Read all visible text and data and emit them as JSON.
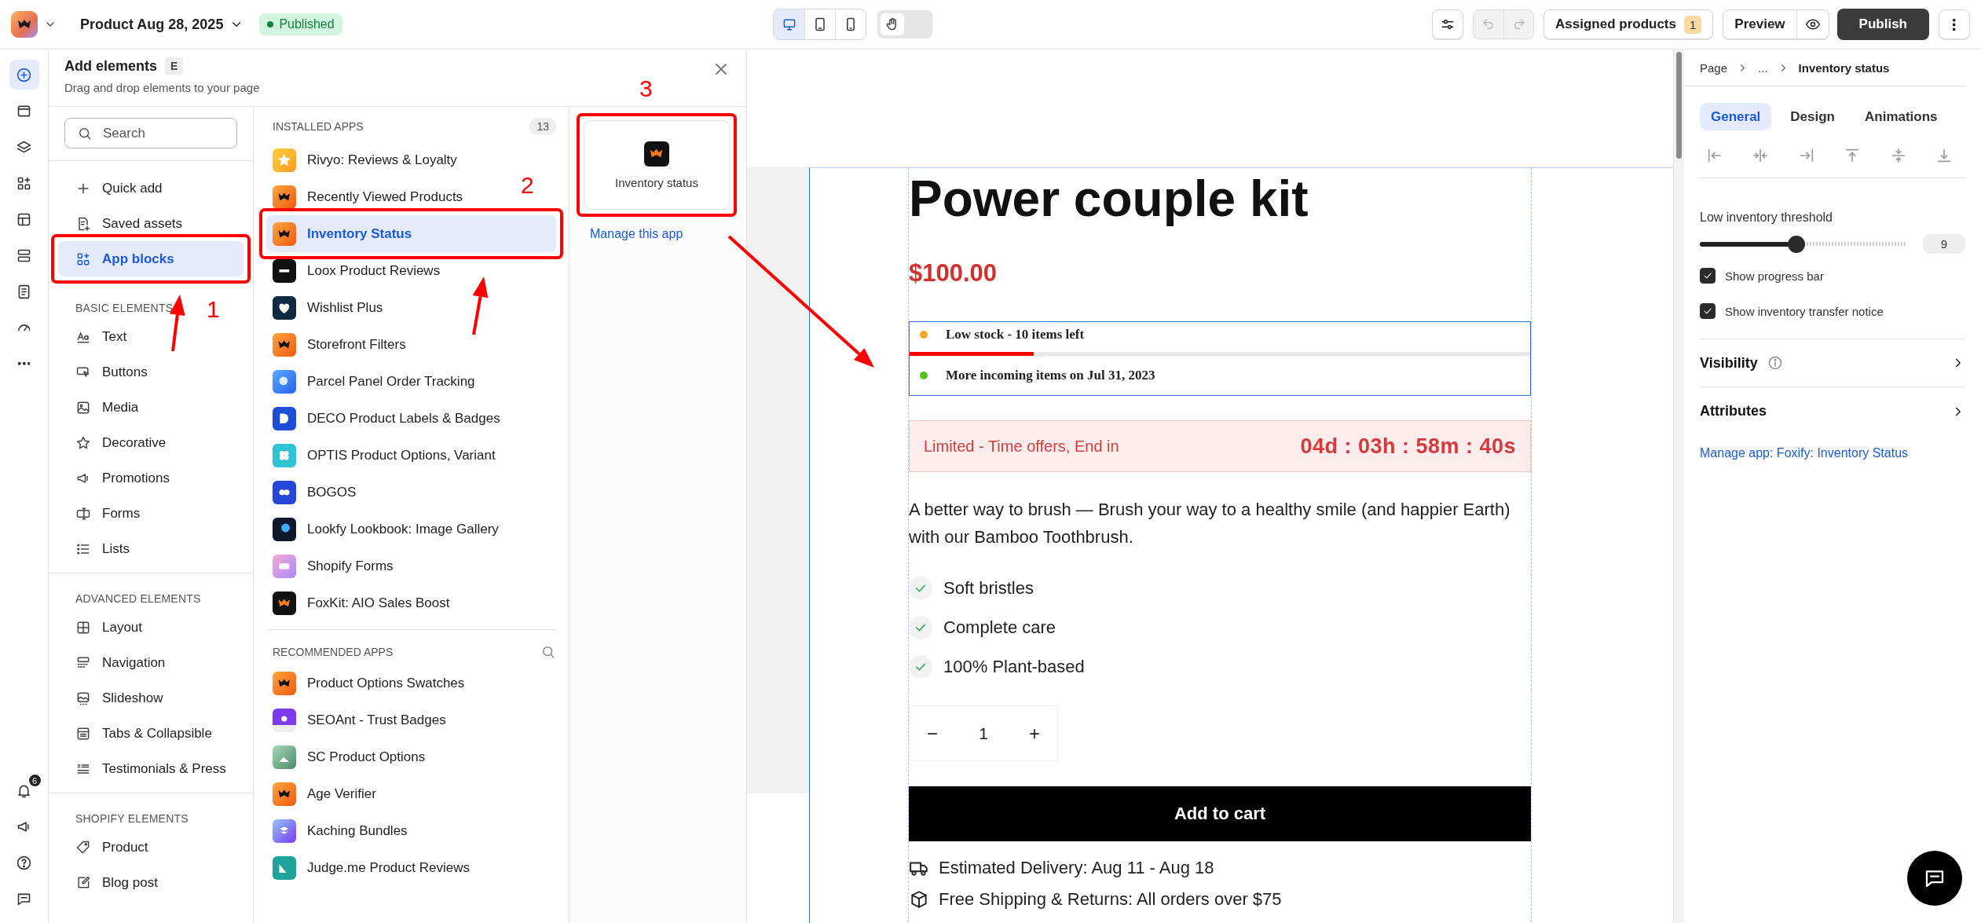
{
  "top_bar": {
    "product_title": "Product Aug 28, 2025",
    "status": "Published",
    "devices": [
      {
        "kind": "desktop",
        "selected": true
      },
      {
        "kind": "tablet",
        "selected": false
      },
      {
        "kind": "mobile",
        "selected": false
      }
    ],
    "hand_tool": {
      "on": false
    },
    "assigned_products": {
      "label": "Assigned products",
      "count": "1"
    },
    "preview": "Preview",
    "publish": "Publish"
  },
  "left_rail": {
    "items": [
      {
        "kind": "add",
        "selected": true
      },
      {
        "kind": "sections",
        "selected": false
      },
      {
        "kind": "layers",
        "selected": false
      },
      {
        "kind": "apps",
        "selected": false
      },
      {
        "kind": "template",
        "selected": false
      },
      {
        "kind": "stack",
        "selected": false
      },
      {
        "kind": "page",
        "selected": false
      },
      {
        "kind": "gauge",
        "selected": false
      },
      {
        "kind": "more",
        "selected": false
      }
    ],
    "bottom_items": [
      {
        "kind": "bell",
        "badge": "6"
      },
      {
        "kind": "megaphone"
      },
      {
        "kind": "help"
      },
      {
        "kind": "chat"
      }
    ]
  },
  "add_elements": {
    "title": "Add elements",
    "shortcut": "E",
    "subtitle": "Drag and drop elements to your page",
    "search": {
      "placeholder": "Search"
    },
    "top_items": [
      {
        "label": "Quick add",
        "kind": "plus",
        "selected": false
      },
      {
        "label": "Saved assets",
        "kind": "saved",
        "selected": false
      },
      {
        "label": "App blocks",
        "kind": "apps",
        "selected": true
      }
    ],
    "groups": [
      {
        "heading": "BASIC ELEMENTS",
        "items": [
          {
            "label": "Text",
            "kind": "text",
            "selected": false
          },
          {
            "label": "Buttons",
            "kind": "cursor",
            "selected": false
          },
          {
            "label": "Media",
            "kind": "image",
            "selected": false
          },
          {
            "label": "Decorative",
            "kind": "star",
            "selected": false
          },
          {
            "label": "Promotions",
            "kind": "megaphone",
            "selected": false
          },
          {
            "label": "Forms",
            "kind": "form",
            "selected": false
          },
          {
            "label": "Lists",
            "kind": "list",
            "selected": false
          }
        ]
      },
      {
        "heading": "ADVANCED ELEMENTS",
        "items": [
          {
            "label": "Layout",
            "kind": "grid",
            "selected": false
          },
          {
            "label": "Navigation",
            "kind": "nav",
            "selected": false
          },
          {
            "label": "Slideshow",
            "kind": "slideshow",
            "selected": false
          },
          {
            "label": "Tabs & Collapsible",
            "kind": "tabs",
            "selected": false
          },
          {
            "label": "Testimonials & Press",
            "kind": "testimonials",
            "selected": false
          }
        ]
      },
      {
        "heading": "SHOPIFY ELEMENTS",
        "items": [
          {
            "label": "Product",
            "kind": "tag",
            "selected": false
          },
          {
            "label": "Blog post",
            "kind": "edit",
            "selected": false
          }
        ]
      }
    ],
    "installed": {
      "heading": "INSTALLED APPS",
      "count": "13",
      "items": [
        {
          "label": "Rivyo: Reviews & Loyalty",
          "kind": "star",
          "selected": false
        },
        {
          "label": "Recently Viewed Products",
          "kind": "foxify",
          "selected": false
        },
        {
          "label": "Inventory Status",
          "kind": "foxify",
          "selected": true
        },
        {
          "label": "Loox Product Reviews",
          "kind": "loox",
          "selected": false
        },
        {
          "label": "Wishlist Plus",
          "kind": "heart",
          "selected": false
        },
        {
          "label": "Storefront Filters",
          "kind": "foxify",
          "selected": false
        },
        {
          "label": "Parcel Panel Order Tracking",
          "kind": "parcel",
          "selected": false
        },
        {
          "label": "DECO Product Labels & Badges",
          "kind": "deco",
          "selected": false
        },
        {
          "label": "OPTIS Product Options, Variant",
          "kind": "optis",
          "selected": false
        },
        {
          "label": "BOGOS",
          "kind": "bogos",
          "selected": false
        },
        {
          "label": "Lookfy Lookbook: Image Gallery",
          "kind": "lookfy",
          "selected": false
        },
        {
          "label": "Shopify Forms",
          "kind": "forms",
          "selected": false
        },
        {
          "label": "FoxKit: AIO Sales Boost",
          "kind": "foxkit",
          "selected": false
        }
      ]
    },
    "recommended": {
      "heading": "RECOMMENDED APPS",
      "items": [
        {
          "label": "Product Options Swatches",
          "kind": "foxify",
          "selected": false
        },
        {
          "label": "SEOAnt - Trust Badges",
          "kind": "seoant",
          "selected": false
        },
        {
          "label": "SC Product Options",
          "kind": "sc",
          "selected": false
        },
        {
          "label": "Age Verifier",
          "kind": "foxify",
          "selected": false
        },
        {
          "label": "Kaching Bundles",
          "kind": "kaching",
          "selected": false
        },
        {
          "label": "Judge.me Product Reviews",
          "kind": "judgeme",
          "selected": false
        }
      ]
    },
    "blocks": [
      {
        "label": "Inventory status",
        "kind": "foxkit"
      }
    ],
    "manage_link": "Manage this app"
  },
  "canvas": {
    "title": "Power couple kit",
    "price": "$100.00",
    "stock": {
      "lines": [
        {
          "text": "Low stock - 10 items left",
          "color": "#f5a623"
        },
        {
          "text": "More incoming items on **Jul 31, 2023**",
          "color": "#52c41a"
        }
      ],
      "progress": {
        "level": 0.2
      }
    },
    "offer": {
      "label": "Limited - Time offers, End in",
      "countdown": "04d : 03h : 58m : 40s"
    },
    "description": "A better way to brush — Brush your way to a healthy smile (and happier Earth) with our Bamboo Toothbrush.",
    "features": [
      "Soft bristles",
      "Complete care",
      "100% Plant-based"
    ],
    "quantity": {
      "minus": "−",
      "value": "1",
      "plus": "+"
    },
    "add_to_cart": "Add to cart",
    "info_lines": [
      {
        "kind": "truck",
        "text": "Estimated Delivery: Aug 11 - Aug 18"
      },
      {
        "kind": "box",
        "text": "Free Shipping & Returns: All orders over $75"
      }
    ]
  },
  "right_panel": {
    "breadcrumb": [
      "Page",
      "...",
      "Inventory status"
    ],
    "tabs": [
      {
        "label": "General",
        "selected": true
      },
      {
        "label": "Design",
        "selected": false
      },
      {
        "label": "Animations",
        "selected": false
      }
    ],
    "align_buttons": [
      {
        "kind": "align-left"
      },
      {
        "kind": "align-center"
      },
      {
        "kind": "align-right"
      },
      {
        "kind": "align-top"
      },
      {
        "kind": "align-middle"
      },
      {
        "kind": "align-bottom"
      }
    ],
    "threshold": {
      "label": "Low inventory threshold",
      "level": 0.47,
      "value": "9"
    },
    "checkboxes": [
      {
        "label": "Show progress bar",
        "checked": true
      },
      {
        "label": "Show inventory transfer notice",
        "checked": true
      }
    ],
    "sections": [
      {
        "label": "Visibility",
        "info": true
      },
      {
        "label": "Attributes",
        "info": false
      }
    ],
    "manage_link": "Manage app: Foxify: Inventory Status"
  },
  "annotations": [
    {
      "number": "1"
    },
    {
      "number": "2"
    },
    {
      "number": "3"
    }
  ]
}
